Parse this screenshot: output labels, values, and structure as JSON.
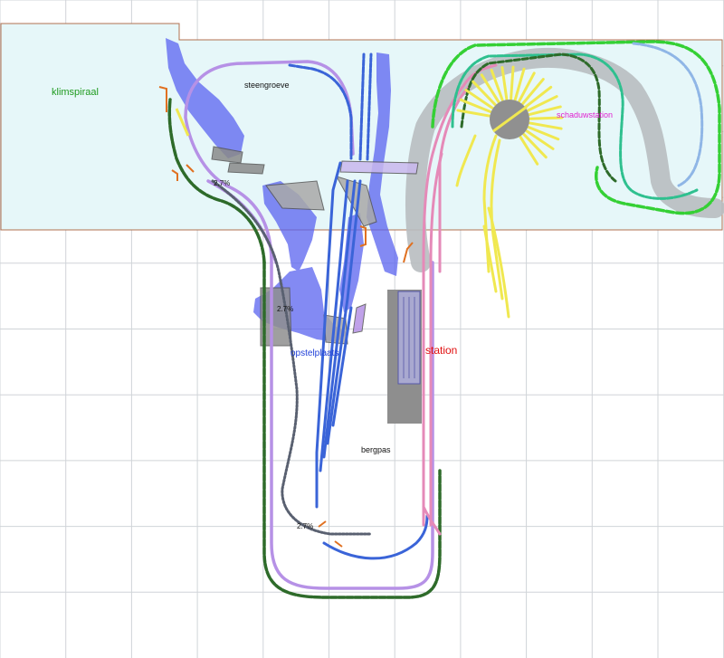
{
  "labels": {
    "klimspiraal": "klimspiraal",
    "steengroeve": "steengroeve",
    "schaduwstation": "schaduwstation",
    "opstelplaats": "opstelplaats",
    "station": "station",
    "bergpas": "bergpas",
    "grade_a": "2.7%",
    "grade_b": "2.7%",
    "grade_c": "2.7%"
  },
  "colors": {
    "grid": "#d0d4d8",
    "upper_level_fill": "#e6f7f9",
    "upper_level_border": "#b07050",
    "water": "#5a63f0",
    "rock": "#b8bcc0",
    "track_lilac": "#b691e6",
    "track_blue": "#3a64d8",
    "track_darkgreen": "#2e6b2a",
    "track_green": "#35d035",
    "track_teal": "#2fc08f",
    "track_pink": "#e58ab8",
    "track_yellow": "#f0e850",
    "track_lightblue": "#8fb6e6",
    "track_grey": "#596070",
    "turntable": "#909090",
    "signal": "#e07020",
    "label_green": "#1f9a1f",
    "label_blue": "#1f3fd8",
    "label_red": "#e01010",
    "label_magenta": "#e020d0",
    "label_black": "#111111"
  }
}
